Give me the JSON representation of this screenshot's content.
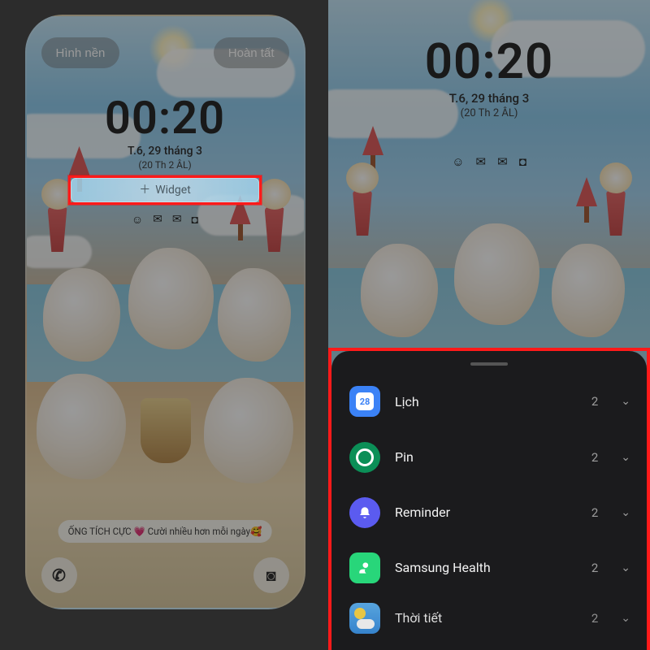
{
  "left": {
    "wallpaper_button": "Hình nền",
    "done_button": "Hoàn tất",
    "clock": "00:20",
    "date": "T.6, 29 tháng 3",
    "date_sub": "(20 Th 2 ÂL)",
    "widget_button": "Widget",
    "caption": "ỐNG TÍCH CỰC 💗 Cười nhiều hơn mỗi ngày🥰"
  },
  "right": {
    "clock": "00:20",
    "date": "T.6, 29 tháng 3",
    "date_sub": "(20 Th 2 ÂL)"
  },
  "sheet": {
    "items": [
      {
        "label": "Lịch",
        "count": "2",
        "icon_badge": "28"
      },
      {
        "label": "Pin",
        "count": "2"
      },
      {
        "label": "Reminder",
        "count": "2"
      },
      {
        "label": "Samsung Health",
        "count": "2"
      },
      {
        "label": "Thời tiết",
        "count": "2"
      }
    ]
  },
  "colors": {
    "highlight": "#ff1a1a",
    "sheet_bg": "#1b1b1d"
  }
}
